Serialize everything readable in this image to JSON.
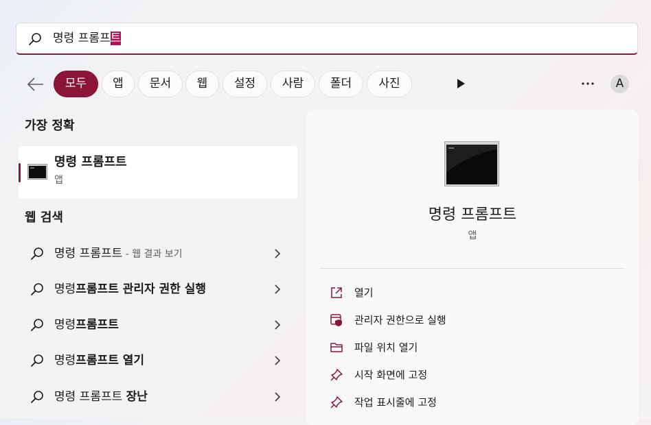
{
  "search": {
    "query_prefix": "명령 프롬프",
    "query_selected": "트"
  },
  "filters": {
    "back_label": "뒤로",
    "tabs": [
      {
        "label": "모두",
        "active": true
      },
      {
        "label": "앱",
        "active": false
      },
      {
        "label": "문서",
        "active": false
      },
      {
        "label": "웹",
        "active": false
      },
      {
        "label": "설정",
        "active": false
      },
      {
        "label": "사람",
        "active": false
      },
      {
        "label": "폴더",
        "active": false
      },
      {
        "label": "사진",
        "active": false
      }
    ],
    "avatar_initial": "A"
  },
  "best_match": {
    "section_title": "가장 정확",
    "name": "명령 프롬프트",
    "type": "앱",
    "icon": "cmd-app-icon"
  },
  "web_search": {
    "section_title": "웹 검색",
    "items": [
      {
        "normal": "명령 프롬프트",
        "bold": "",
        "hint": " - 웹 결과 보기"
      },
      {
        "normal": "명령",
        "bold": "프롬프트 관리자 권한 실행",
        "hint": ""
      },
      {
        "normal": "명령",
        "bold": "프롬프트",
        "hint": ""
      },
      {
        "normal": "명령",
        "bold": "프롬프트 열기",
        "hint": ""
      },
      {
        "normal": "명령 프롬프트 ",
        "bold": "장난",
        "hint": ""
      }
    ]
  },
  "detail": {
    "title": "명령 프롬프트",
    "subtitle": "앱",
    "actions": [
      {
        "label": "열기",
        "icon": "open-external-icon"
      },
      {
        "label": "관리자 권한으로 실행",
        "icon": "shield-admin-icon"
      },
      {
        "label": "파일 위치 열기",
        "icon": "folder-icon"
      },
      {
        "label": "시작 화면에 고정",
        "icon": "pin-icon"
      },
      {
        "label": "작업 표시줄에 고정",
        "icon": "pin-icon"
      }
    ]
  },
  "colors": {
    "accent": "#8a1538",
    "selection": "#b3105a",
    "panel": "#f9f9f9"
  }
}
